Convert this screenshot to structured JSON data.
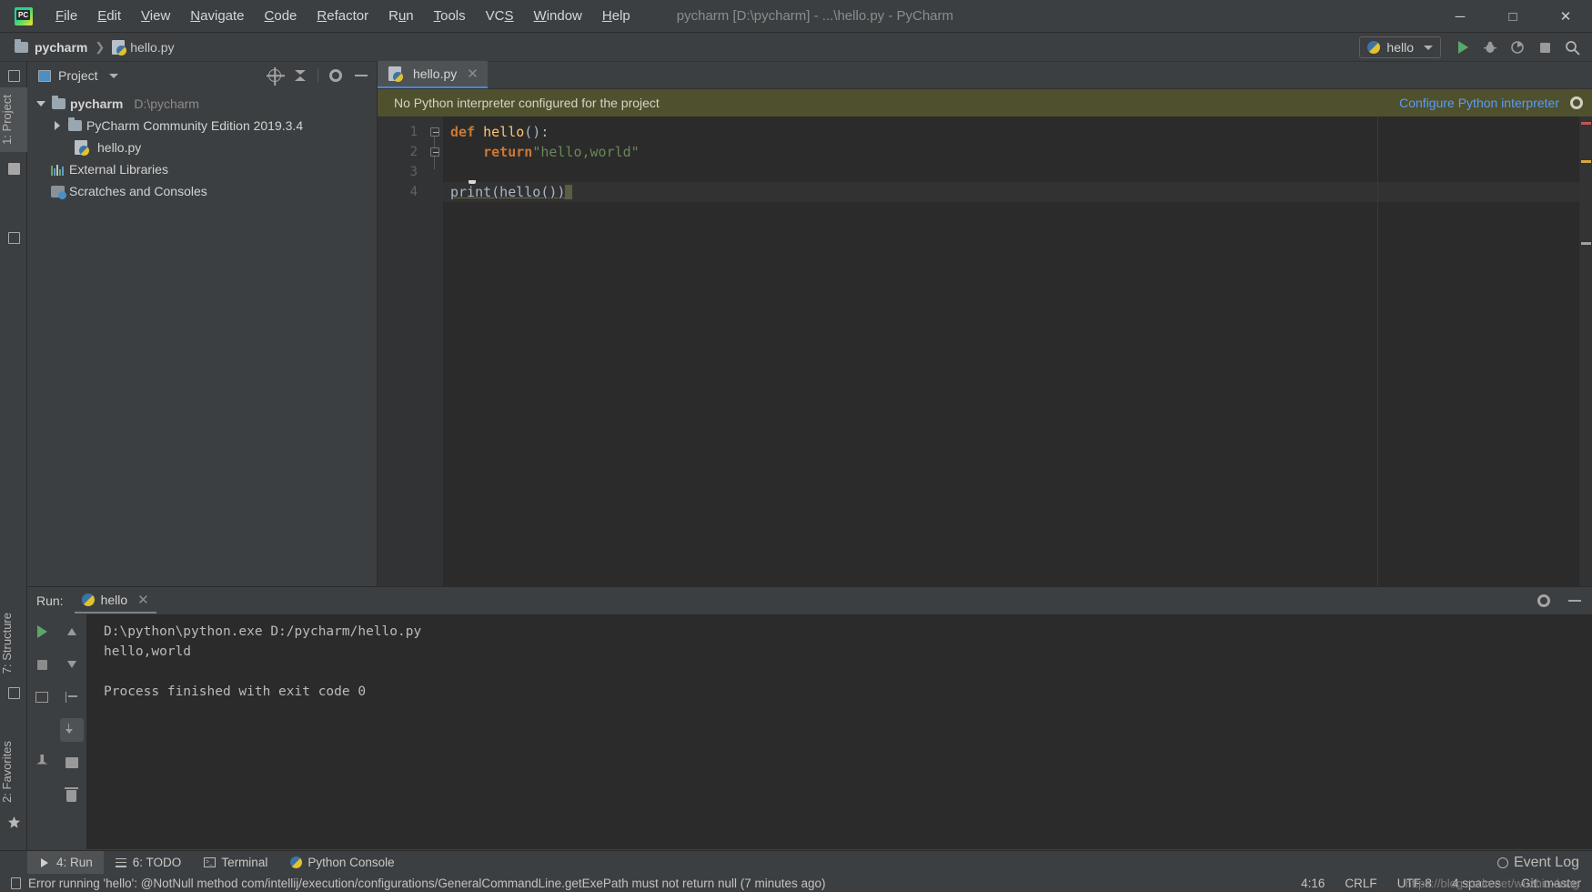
{
  "window": {
    "title": "pycharm [D:\\pycharm] - ...\\hello.py - PyCharm",
    "minimize": "─",
    "maximize": "□",
    "close": "✕"
  },
  "menubar": {
    "items": [
      {
        "label": "File",
        "mnemonic": "F"
      },
      {
        "label": "Edit",
        "mnemonic": "E"
      },
      {
        "label": "View",
        "mnemonic": "V"
      },
      {
        "label": "Navigate",
        "mnemonic": "N"
      },
      {
        "label": "Code",
        "mnemonic": "C"
      },
      {
        "label": "Refactor",
        "mnemonic": "R"
      },
      {
        "label": "Run",
        "mnemonic": "u"
      },
      {
        "label": "Tools",
        "mnemonic": "T"
      },
      {
        "label": "VCS",
        "mnemonic": "S"
      },
      {
        "label": "Window",
        "mnemonic": "W"
      },
      {
        "label": "Help",
        "mnemonic": "H"
      }
    ]
  },
  "navbar": {
    "project_crumb": "pycharm",
    "separator": "❯",
    "file_crumb": "hello.py",
    "run_config": "hello"
  },
  "left_strip": {
    "project_tab": "1: Project",
    "structure_tab": "7: Structure",
    "favorites_tab": "2: Favorites"
  },
  "project_panel": {
    "title": "Project",
    "tree": [
      {
        "label": "pycharm",
        "sublabel": "D:\\pycharm",
        "icon": "folder-icon",
        "arrow": "down",
        "indent": 0,
        "bold": true
      },
      {
        "label": "PyCharm Community Edition 2019.3.4",
        "sublabel": "",
        "icon": "folder-icon",
        "arrow": "right",
        "indent": 1,
        "bold": false
      },
      {
        "label": "hello.py",
        "sublabel": "",
        "icon": "python-file-icon",
        "arrow": "none",
        "indent": 1,
        "bold": false
      },
      {
        "label": "External Libraries",
        "sublabel": "",
        "icon": "library-icon",
        "arrow": "none",
        "indent": 0,
        "bold": false
      },
      {
        "label": "Scratches and Consoles",
        "sublabel": "",
        "icon": "scratch-icon",
        "arrow": "none",
        "indent": 0,
        "bold": false
      }
    ]
  },
  "editor": {
    "tab_label": "hello.py",
    "tab_close": "✕",
    "notification": {
      "message": "No Python interpreter configured for the project",
      "link": "Configure Python interpreter"
    },
    "line_numbers": [
      "1",
      "2",
      "3",
      "4"
    ],
    "code": {
      "line1_kw": "def",
      "line1_fn": " hello",
      "line1_tail": "():",
      "line2_kw": "    return",
      "line2_str": "\"hello,world\"",
      "line4": "print(hello())"
    }
  },
  "run_panel": {
    "label": "Run:",
    "tab_label": "hello",
    "tab_close": "✕",
    "output": [
      "D:\\python\\python.exe D:/pycharm/hello.py",
      "hello,world",
      "",
      "Process finished with exit code 0"
    ]
  },
  "bottom_toolbar": {
    "items": [
      {
        "label": "4: Run",
        "mnemonic": "4",
        "icon": "play-icon",
        "active": true
      },
      {
        "label": "6: TODO",
        "mnemonic": "6",
        "icon": "list-icon",
        "active": false
      },
      {
        "label": "Terminal",
        "mnemonic": "",
        "icon": "terminal-icon",
        "active": false
      },
      {
        "label": "Python Console",
        "mnemonic": "",
        "icon": "python-console-icon",
        "active": false
      }
    ],
    "event_log": "Event Log"
  },
  "status_bar": {
    "message": "Error running 'hello': @NotNull method com/intellij/execution/configurations/GeneralCommandLine.getExePath must not return null (7 minutes ago)",
    "caret": "4:16",
    "line_sep": "CRLF",
    "encoding": "UTF-8",
    "indent": "4 spaces",
    "branch": "Git: master",
    "watermark": "https://blog.csdn.net/wuzhiuxiang"
  },
  "colors": {
    "accent": "#4a88c7",
    "link": "#589df6",
    "notify_bg": "#4f502e",
    "keyword": "#cc7832",
    "string": "#6a8759",
    "function": "#ffc66d",
    "run_green": "#59a869",
    "editor_bg": "#2b2b2b",
    "chrome_bg": "#3c3f41"
  }
}
